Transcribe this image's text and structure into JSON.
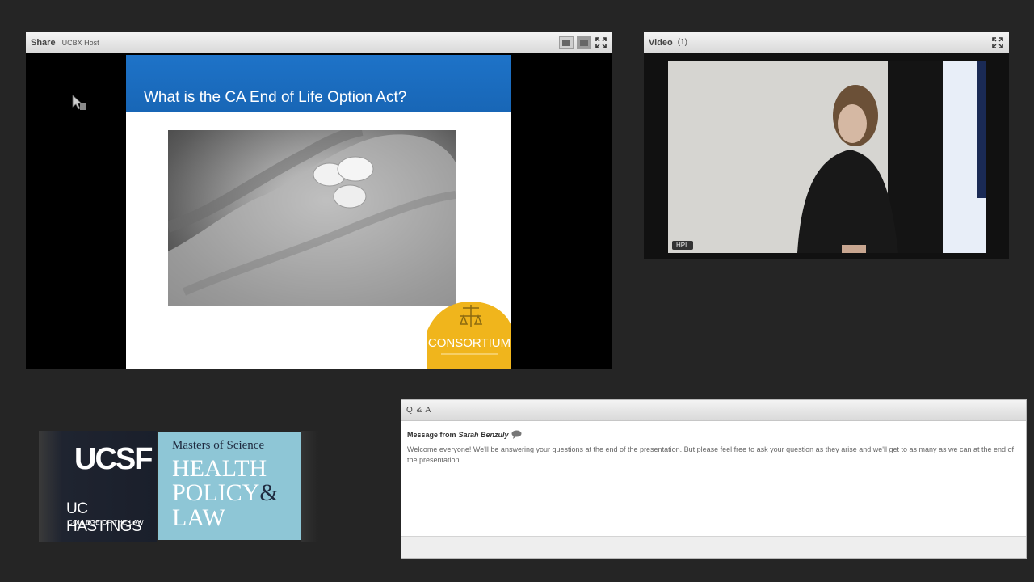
{
  "share_pod": {
    "title": "Share",
    "presenter": "UCBX Host",
    "slide": {
      "title": "What is the CA End of Life Option Act?",
      "seal_text": "CONSORTIUM"
    }
  },
  "video_pod": {
    "title": "Video",
    "count": "(1)",
    "feed_label": "HPL"
  },
  "logo": {
    "ucsf": "UCSF",
    "uc_hastings": "UC HASTINGS",
    "college": "COLLEGE OF THE LAW",
    "masters": "Masters of Science",
    "line1": "HEALTH",
    "line2": "POLICY",
    "amp": "&",
    "line3": "LAW"
  },
  "qa_pod": {
    "title": "Q & A",
    "message_prefix": "Message from",
    "message_author": "Sarah Benzuly",
    "message_text": "Welcome everyone! We'll be answering your questions at the end of the presentation. But please feel free to ask your question as they arise and we'll get to as many as we can at the end of the presentation"
  },
  "colors": {
    "background": "#252525",
    "slide_band": "#1e73c8",
    "logo_teal": "#8ec6d6",
    "seal_gold": "#f0b51c"
  }
}
